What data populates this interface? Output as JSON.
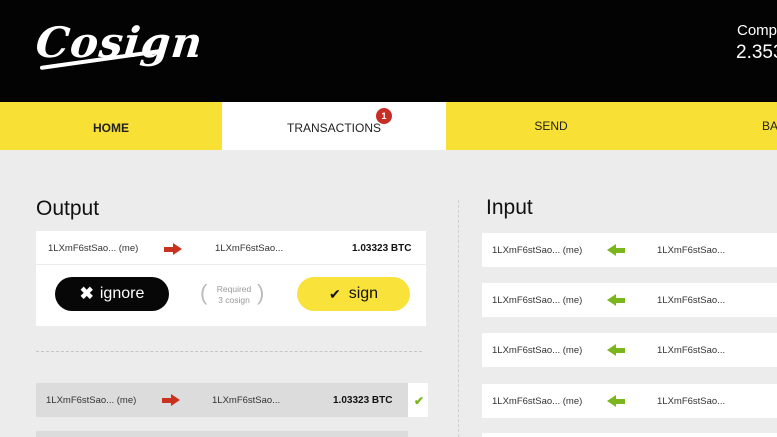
{
  "header": {
    "logo": "Cosign",
    "company_label": "Compa",
    "balance": "2.353"
  },
  "nav": {
    "items": [
      "HOME",
      "TRANSACTIONS",
      "SEND",
      "BA"
    ],
    "badge_count": "1"
  },
  "output": {
    "title": "Output",
    "pending": {
      "from": "1LXmF6stSao... (me)",
      "to": "1LXmF6stSao...",
      "amount": "1.03323 BTC",
      "ignore_label": "ignore",
      "sign_label": "sign",
      "required_line1": "Required",
      "required_line2": "3 cosign"
    },
    "history": [
      {
        "from": "1LXmF6stSao... (me)",
        "to": "1LXmF6stSao...",
        "amount": "1.03323 BTC",
        "status_icon": "check-icon"
      }
    ]
  },
  "input": {
    "title": "Input",
    "rows": [
      {
        "from": "1LXmF6stSao... (me)",
        "to": "1LXmF6stSao..."
      },
      {
        "from": "1LXmF6stSao... (me)",
        "to": "1LXmF6stSao..."
      },
      {
        "from": "1LXmF6stSao... (me)",
        "to": "1LXmF6stSao..."
      },
      {
        "from": "1LXmF6stSao... (me)",
        "to": "1LXmF6stSao..."
      }
    ]
  },
  "colors": {
    "accent_yellow": "#f8e134",
    "header_black": "#030303",
    "badge_red": "#c62f26",
    "out_arrow_red": "#c8321f",
    "in_arrow_green": "#7bb61f"
  }
}
